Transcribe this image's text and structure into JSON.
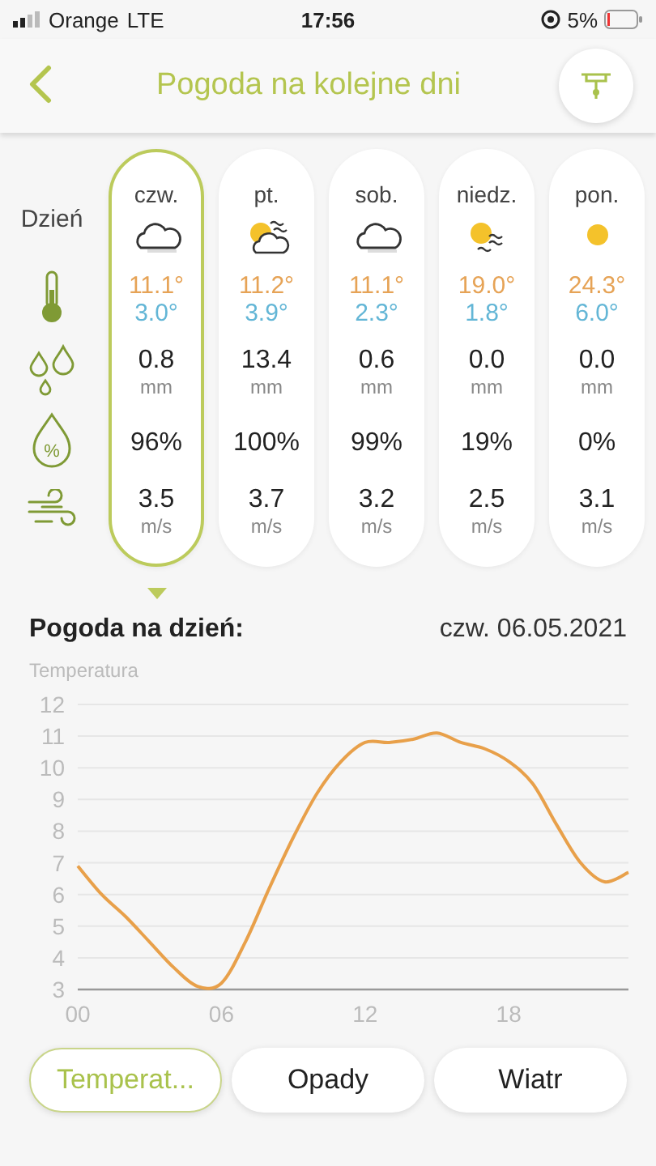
{
  "status_bar": {
    "carrier": "Orange",
    "network": "LTE",
    "time": "17:56",
    "battery": "5%"
  },
  "header": {
    "title": "Pogoda na kolejne dni"
  },
  "row_label": "Dzień",
  "humidity_symbol": "%",
  "days": [
    {
      "day": "czw.",
      "kind": "cloudy",
      "high": "11.1°",
      "low": "3.0°",
      "precipitation": "0.8",
      "precipitation_unit": "mm",
      "humidity": "96%",
      "wind": "3.5",
      "wind_unit": "m/s",
      "selected": true
    },
    {
      "day": "pt.",
      "kind": "sun_cloud_wind",
      "high": "11.2°",
      "low": "3.9°",
      "precipitation": "13.4",
      "precipitation_unit": "mm",
      "humidity": "100%",
      "wind": "3.7",
      "wind_unit": "m/s",
      "selected": false
    },
    {
      "day": "sob.",
      "kind": "cloudy",
      "high": "11.1°",
      "low": "2.3°",
      "precipitation": "0.6",
      "precipitation_unit": "mm",
      "humidity": "99%",
      "wind": "3.2",
      "wind_unit": "m/s",
      "selected": false
    },
    {
      "day": "niedz.",
      "kind": "sun_wind",
      "high": "19.0°",
      "low": "1.8°",
      "precipitation": "0.0",
      "precipitation_unit": "mm",
      "humidity": "19%",
      "wind": "2.5",
      "wind_unit": "m/s",
      "selected": false
    },
    {
      "day": "pon.",
      "kind": "sun",
      "high": "24.3°",
      "low": "6.0°",
      "precipitation": "0.0",
      "precipitation_unit": "mm",
      "humidity": "0%",
      "wind": "3.1",
      "wind_unit": "m/s",
      "selected": false
    }
  ],
  "detail": {
    "title": "Pogoda na dzień:",
    "date": "czw. 06.05.2021",
    "chart_data": {
      "type": "line",
      "grid": true,
      "x": [
        0,
        1,
        2,
        3,
        4,
        5,
        6,
        7,
        8,
        9,
        10,
        11,
        12,
        13,
        14,
        15,
        16,
        17,
        18,
        19,
        20,
        21,
        22,
        23
      ],
      "series": [
        {
          "name": "Temperatura",
          "color": "#e8a04a",
          "values": [
            6.9,
            6.0,
            5.3,
            4.5,
            3.7,
            3.1,
            3.2,
            4.5,
            6.2,
            7.8,
            9.2,
            10.2,
            10.8,
            10.8,
            10.9,
            11.1,
            10.8,
            10.6,
            10.2,
            9.5,
            8.2,
            7.0,
            6.4,
            6.7
          ]
        }
      ],
      "xlim": [
        0,
        23
      ],
      "ylim": [
        3,
        12
      ],
      "xticks": [
        {
          "value": 0,
          "label": "00"
        },
        {
          "value": 6,
          "label": "06"
        },
        {
          "value": 12,
          "label": "12"
        },
        {
          "value": 18,
          "label": "18"
        }
      ],
      "yticks": [
        3,
        4,
        5,
        6,
        7,
        8,
        9,
        10,
        11,
        12
      ]
    }
  },
  "tabs": [
    {
      "label": "Temperat...",
      "selected": true
    },
    {
      "label": "Opady",
      "selected": false
    },
    {
      "label": "Wiatr",
      "selected": false
    }
  ]
}
